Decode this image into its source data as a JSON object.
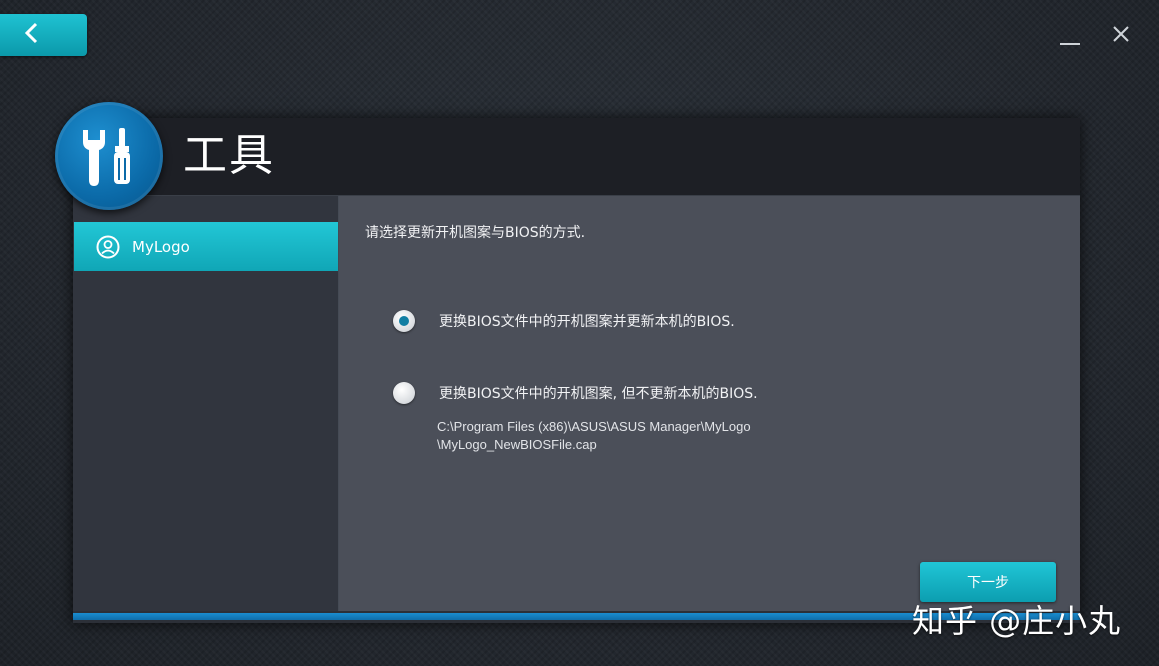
{
  "window": {
    "back_icon": "chevron-left-icon",
    "minimize_icon": "minimize-icon",
    "close_icon": "close-icon"
  },
  "panel": {
    "title": "工具",
    "logo_icon": "wrench-screwdriver-icon"
  },
  "sidebar": {
    "items": [
      {
        "label": "MyLogo",
        "icon": "user-circle-icon",
        "selected": true
      }
    ]
  },
  "content": {
    "instruction": "请选择更新开机图案与BIOS的方式.",
    "options": [
      {
        "label": "更换BIOS文件中的开机图案并更新本机的BIOS.",
        "checked": true
      },
      {
        "label": "更换BIOS文件中的开机图案, 但不更新本机的BIOS.",
        "checked": false
      }
    ],
    "file_path_line1": "C:\\Program Files (x86)\\ASUS\\ASUS Manager\\MyLogo",
    "file_path_line2": "\\MyLogo_NewBIOSFile.cap",
    "next_label": "下一步"
  },
  "watermark": "知乎 @庄小丸",
  "colors": {
    "accent_cyan": "#14b4c4",
    "logo_blue": "#0b6aa8",
    "progress_blue": "#1a8dd0"
  }
}
